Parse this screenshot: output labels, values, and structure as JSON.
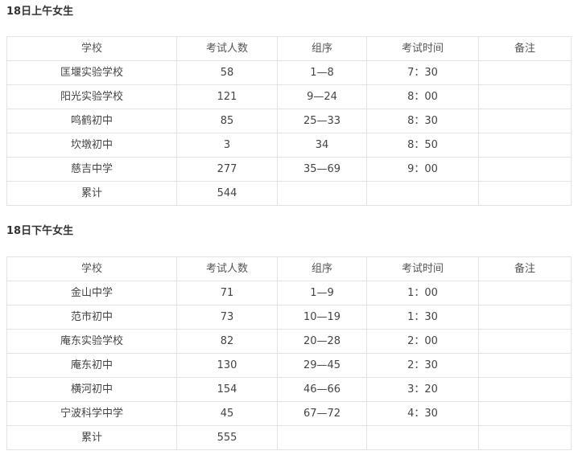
{
  "sections": [
    {
      "title": "18日上午女生",
      "headers": [
        "学校",
        "考试人数",
        "组序",
        "考试时间",
        "备注"
      ],
      "rows": [
        {
          "school": "匡堰实验学校",
          "count": "58",
          "group": "1—8",
          "time": "7：30",
          "note": ""
        },
        {
          "school": "阳光实验学校",
          "count": "121",
          "group": "9—24",
          "time": "8：00",
          "note": ""
        },
        {
          "school": "鸣鹤初中",
          "count": "85",
          "group": "25—33",
          "time": "8：30",
          "note": ""
        },
        {
          "school": "坎墩初中",
          "count": "3",
          "group": "34",
          "time": "8：50",
          "note": ""
        },
        {
          "school": "慈吉中学",
          "count": "277",
          "group": "35—69",
          "time": "9：00",
          "note": ""
        }
      ],
      "total": {
        "label": "累计",
        "count": "544"
      }
    },
    {
      "title": "18日下午女生",
      "headers": [
        "学校",
        "考试人数",
        "组序",
        "考试时间",
        "备注"
      ],
      "rows": [
        {
          "school": "金山中学",
          "count": "71",
          "group": "1—9",
          "time": "1：00",
          "note": ""
        },
        {
          "school": "范市初中",
          "count": "73",
          "group": "10—19",
          "time": "1：30",
          "note": ""
        },
        {
          "school": "庵东实验学校",
          "count": "82",
          "group": "20—28",
          "time": "2：00",
          "note": ""
        },
        {
          "school": "庵东初中",
          "count": "130",
          "group": "29—45",
          "time": "2：30",
          "note": ""
        },
        {
          "school": "横河初中",
          "count": "154",
          "group": "46—66",
          "time": "3：20",
          "note": ""
        },
        {
          "school": "宁波科学中学",
          "count": "45",
          "group": "67—72",
          "time": "4：30",
          "note": ""
        }
      ],
      "total": {
        "label": "累计",
        "count": "555"
      }
    }
  ]
}
